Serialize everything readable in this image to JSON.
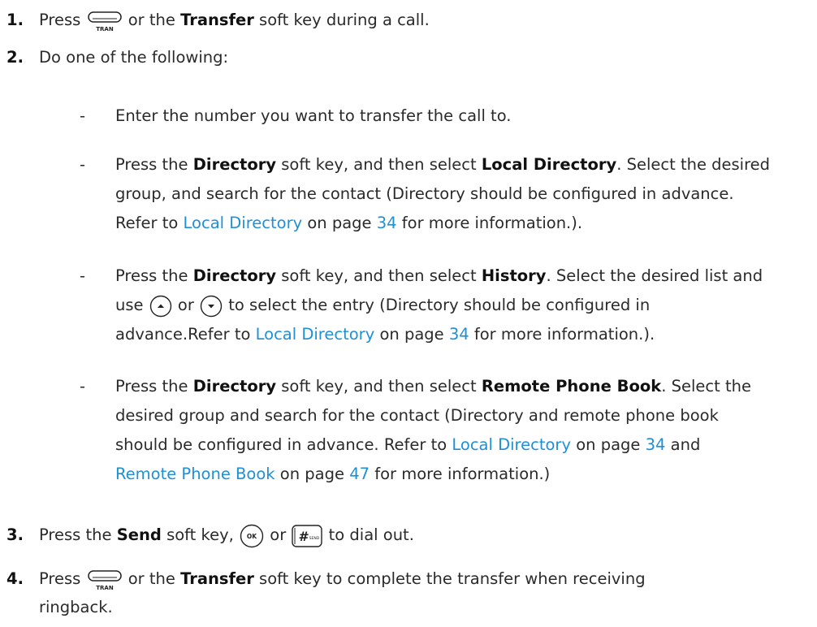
{
  "steps": {
    "s1": {
      "num": "1.",
      "press": "Press",
      "tran_label": "TRAN",
      "a": "or the",
      "key": "Transfer",
      "b": "soft key during a call."
    },
    "s2": {
      "num": "2.",
      "text": "Do one of the following:"
    },
    "s3": {
      "num": "3.",
      "press": "Press the",
      "key": "Send",
      "a": "soft key,",
      "ok_label": "OK",
      "b": "or",
      "send_label": "SEND",
      "c": "to dial out."
    },
    "s4": {
      "num": "4.",
      "press": "Press",
      "tran_label": "TRAN",
      "a": "or the",
      "key": "Transfer",
      "b": "soft key to complete the transfer when receiving",
      "c": "ringback."
    }
  },
  "options": {
    "dash": "-",
    "o1": {
      "text": "Enter the number you want to transfer the call to."
    },
    "o2": {
      "a": "Press the",
      "k1": "Directory",
      "b": "soft key, and then select",
      "k2": "Local Directory",
      "c": ". Select the desired",
      "line2": "group, and search for the contact (Directory should be configured in advance.",
      "d": "Refer to",
      "link": "Local Directory",
      "e": "on page",
      "page": "34",
      "f": "for more information.)."
    },
    "o3": {
      "a": "Press the",
      "k1": "Directory",
      "b": "soft key, and then select",
      "k2": "History",
      "c": ". Select the desired list and",
      "d": "use",
      "e": "or",
      "f": "to select the entry (Directory should be configured in",
      "g": "advance.Refer to",
      "link": "Local Directory",
      "h": "on page",
      "page": "34",
      "i": "for more information.)."
    },
    "o4": {
      "a": "Press the",
      "k1": "Directory",
      "b": "soft key, and then select",
      "k2": "Remote Phone Book",
      "c": ". Select the",
      "line2": "desired group and search for the contact (Directory and remote phone book",
      "d": "should be configured in advance. Refer to",
      "link1": "Local Directory",
      "e": "on page",
      "page1": "34",
      "f": "and",
      "link2": "Remote Phone Book",
      "g": "on page",
      "page2": "47",
      "h": "for more information.)"
    }
  }
}
